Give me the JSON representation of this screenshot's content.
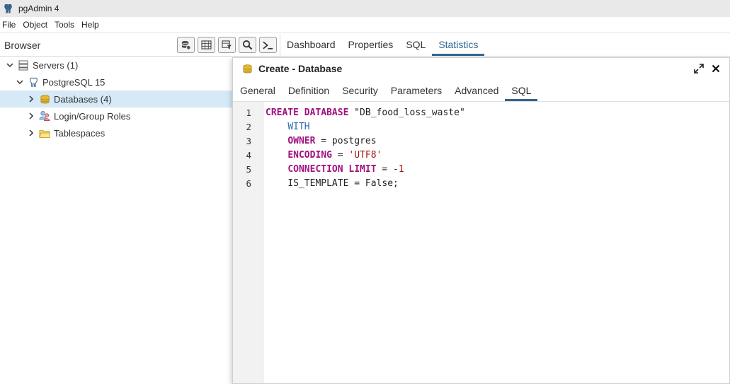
{
  "titlebar": {
    "title": "pgAdmin 4"
  },
  "menubar": {
    "items": [
      "File",
      "Object",
      "Tools",
      "Help"
    ]
  },
  "browser": {
    "label": "Browser",
    "toolbar": [
      "database-icon",
      "table-grid-icon",
      "filter-table-icon",
      "search-icon",
      "terminal-icon"
    ],
    "tree": [
      {
        "label": "Servers (1)",
        "icon": "servers-icon"
      },
      {
        "label": "PostgreSQL 15",
        "icon": "postgres-elephant-icon"
      },
      {
        "label": "Databases (4)",
        "icon": "databases-icon"
      },
      {
        "label": "Login/Group Roles",
        "icon": "roles-icon"
      },
      {
        "label": "Tablespaces",
        "icon": "folder-icon"
      }
    ]
  },
  "main_tabs": [
    "Dashboard",
    "Properties",
    "SQL",
    "Statistics"
  ],
  "dialog": {
    "title": "Create - Database",
    "tabs": [
      "General",
      "Definition",
      "Security",
      "Parameters",
      "Advanced",
      "SQL"
    ],
    "active_tab": "SQL",
    "line_numbers": [
      "1",
      "2",
      "3",
      "4",
      "5",
      "6"
    ],
    "code": {
      "l1_kw": "CREATE DATABASE",
      "l1_name": " \"DB_food_loss_waste\"",
      "l2_kw": "WITH",
      "l3_kw": "OWNER",
      "l3_rest": " = postgres",
      "l4_kw": "ENCODING",
      "l4_eq": " = ",
      "l4_str": "'UTF8'",
      "l5_kw": "CONNECTION LIMIT",
      "l5_eq": " = -",
      "l5_num": "1",
      "l6_text": "IS_TEMPLATE = False;"
    }
  },
  "colors": {
    "accent": "#326690",
    "selected_row": "#d5e9f7",
    "keyword": "#a0117f",
    "string": "#a31515"
  }
}
